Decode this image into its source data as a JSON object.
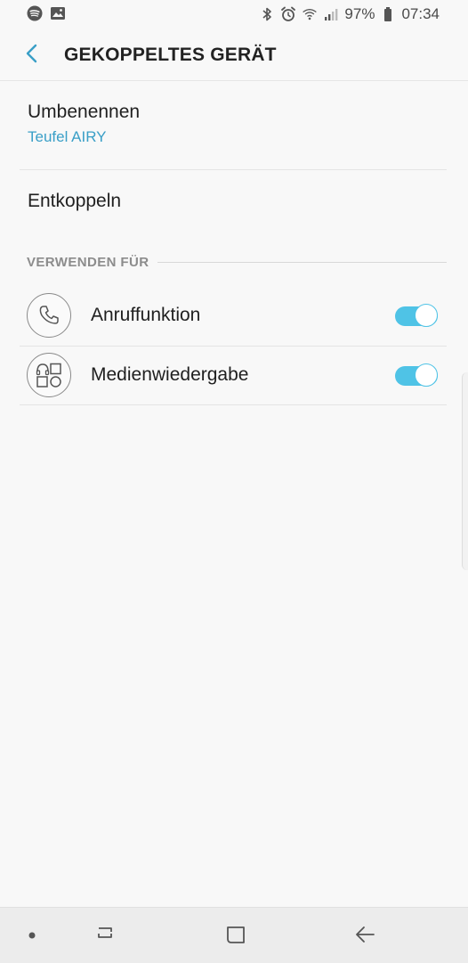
{
  "status_bar": {
    "left_icons": [
      "spotify-icon",
      "image-icon"
    ],
    "right_icons": [
      "bluetooth-icon",
      "alarm-icon",
      "wifi-icon",
      "signal-icon",
      "battery-icon"
    ],
    "battery": "97%",
    "time": "07:34"
  },
  "header": {
    "title": "GEKOPPELTES GERÄT",
    "back_icon": "chevron-left-icon"
  },
  "rename": {
    "title": "Umbenennen",
    "device_name": "Teufel AIRY"
  },
  "unpair": {
    "title": "Entkoppeln"
  },
  "use_for": {
    "section_label": "VERWENDEN FÜR",
    "items": [
      {
        "label": "Anruffunktion",
        "icon": "phone-icon",
        "enabled": true
      },
      {
        "label": "Medienwiedergabe",
        "icon": "media-icon",
        "enabled": true
      }
    ]
  },
  "colors": {
    "accent": "#3a9fc7",
    "toggle_on": "#4fc3e6",
    "background": "#f8f8f8"
  },
  "nav_bar": {
    "buttons": [
      "dot-icon",
      "recent-apps-icon",
      "home-icon",
      "back-arrow-icon"
    ]
  }
}
